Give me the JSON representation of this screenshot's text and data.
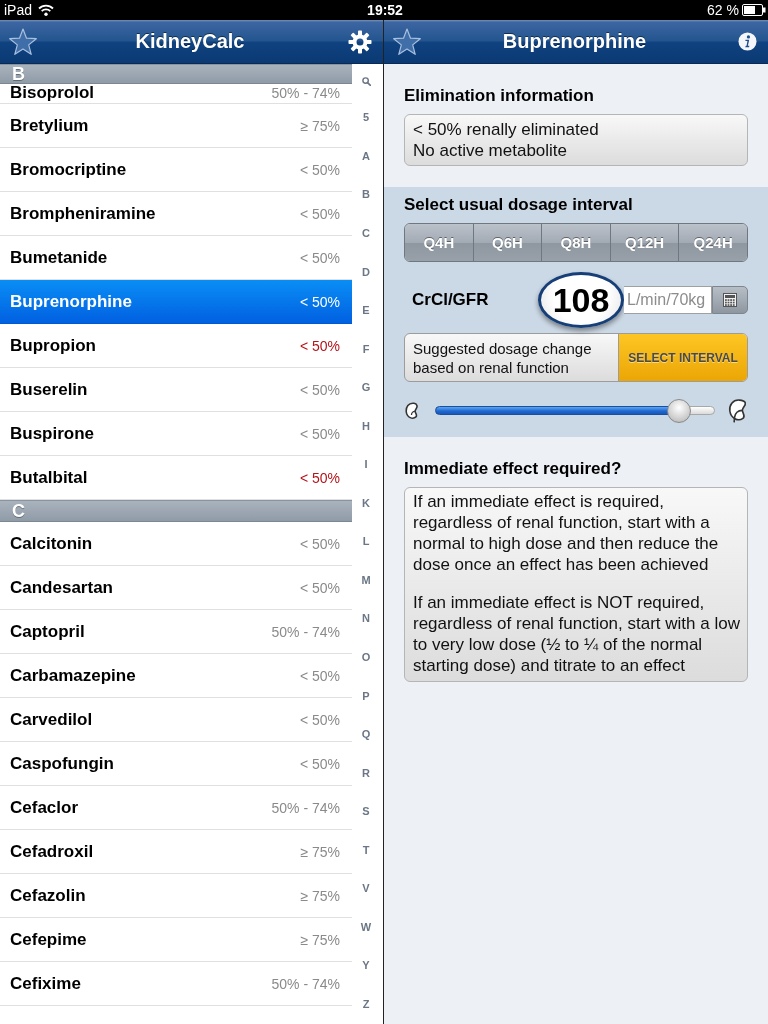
{
  "status_bar": {
    "device": "iPad",
    "time": "19:52",
    "battery": "62 %"
  },
  "list_pane": {
    "nav_bar": {
      "title": "KidneyCalc"
    },
    "sections": [
      {
        "letter": "B",
        "rows": [
          {
            "name": "Bisoprolol",
            "elimination": "50% - 74%",
            "selected": false,
            "flagged": false
          },
          {
            "name": "Bretylium",
            "elimination": "≥ 75%",
            "selected": false,
            "flagged": false
          },
          {
            "name": "Bromocriptine",
            "elimination": "< 50%",
            "selected": false,
            "flagged": false
          },
          {
            "name": "Brompheniramine",
            "elimination": "< 50%",
            "selected": false,
            "flagged": false
          },
          {
            "name": "Bumetanide",
            "elimination": "< 50%",
            "selected": false,
            "flagged": false
          },
          {
            "name": "Buprenorphine",
            "elimination": "< 50%",
            "selected": true,
            "flagged": false
          },
          {
            "name": "Bupropion",
            "elimination": "< 50%",
            "selected": false,
            "flagged": true
          },
          {
            "name": "Buserelin",
            "elimination": "< 50%",
            "selected": false,
            "flagged": false
          },
          {
            "name": "Buspirone",
            "elimination": "< 50%",
            "selected": false,
            "flagged": false
          },
          {
            "name": "Butalbital",
            "elimination": "< 50%",
            "selected": false,
            "flagged": true
          }
        ]
      },
      {
        "letter": "C",
        "rows": [
          {
            "name": "Calcitonin",
            "elimination": "< 50%",
            "selected": false,
            "flagged": false
          },
          {
            "name": "Candesartan",
            "elimination": "< 50%",
            "selected": false,
            "flagged": false
          },
          {
            "name": "Captopril",
            "elimination": "50% - 74%",
            "selected": false,
            "flagged": false
          },
          {
            "name": "Carbamazepine",
            "elimination": "< 50%",
            "selected": false,
            "flagged": false
          },
          {
            "name": "Carvedilol",
            "elimination": "< 50%",
            "selected": false,
            "flagged": false
          },
          {
            "name": "Caspofungin",
            "elimination": "< 50%",
            "selected": false,
            "flagged": false
          },
          {
            "name": "Cefaclor",
            "elimination": "50% - 74%",
            "selected": false,
            "flagged": false
          },
          {
            "name": "Cefadroxil",
            "elimination": "≥ 75%",
            "selected": false,
            "flagged": false
          },
          {
            "name": "Cefazolin",
            "elimination": "≥ 75%",
            "selected": false,
            "flagged": false
          },
          {
            "name": "Cefepime",
            "elimination": "≥ 75%",
            "selected": false,
            "flagged": false
          },
          {
            "name": "Cefixime",
            "elimination": "50% - 74%",
            "selected": false,
            "flagged": false
          }
        ]
      }
    ],
    "index": [
      "5",
      "A",
      "B",
      "C",
      "D",
      "E",
      "F",
      "G",
      "H",
      "I",
      "K",
      "L",
      "M",
      "N",
      "O",
      "P",
      "Q",
      "R",
      "S",
      "T",
      "V",
      "W",
      "Y",
      "Z"
    ]
  },
  "detail_pane": {
    "nav_bar": {
      "title": "Buprenorphine"
    },
    "elimination": {
      "heading": "Elimination information",
      "lines": [
        "< 50% renally eliminated",
        "No active metabolite"
      ]
    },
    "dosage": {
      "heading": "Select usual dosage interval",
      "intervals": [
        {
          "label": "Q4H",
          "selected": false
        },
        {
          "label": "Q6H",
          "selected": false
        },
        {
          "label": "Q8H",
          "selected": false
        },
        {
          "label": "Q12H",
          "selected": false
        },
        {
          "label": "Q24H",
          "selected": false
        }
      ],
      "crcl": {
        "label": "CrCl/GFR",
        "value": "108",
        "placeholder": "L/min/70kg"
      },
      "suggestion": {
        "lines": [
          "Suggested dosage change",
          "based on renal function"
        ],
        "button": "SELECT INTERVAL"
      },
      "renal_slider": {
        "level": 0.87
      }
    },
    "immediate": {
      "heading": "Immediate effect required?",
      "paragraphs": [
        {
          "lines": [
            "If an immediate effect is required,",
            "regardless of renal function, start with a",
            "normal to high dose and then reduce the",
            "dose once an effect has been achieved"
          ]
        },
        {
          "lines": [
            "If an immediate effect is NOT required,",
            "regardless of renal function, start with a low",
            "to very low dose (½ to ¼ of the normal",
            "starting dose) and titrate to an effect"
          ]
        }
      ]
    }
  }
}
